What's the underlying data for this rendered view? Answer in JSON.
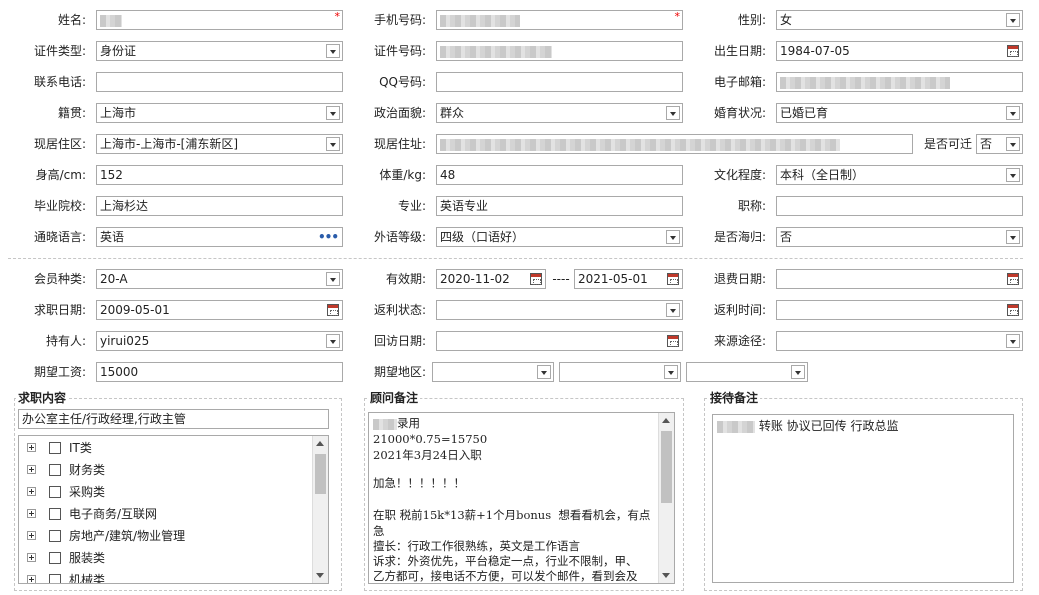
{
  "row1": {
    "name_label": "姓名:",
    "phone_label": "手机号码:",
    "gender_label": "性别:",
    "gender_value": "女"
  },
  "row2": {
    "idtype_label": "证件类型:",
    "idtype_value": "身份证",
    "idnum_label": "证件号码:",
    "birth_label": "出生日期:",
    "birth_value": "1984-07-05"
  },
  "row3": {
    "tel_label": "联系电话:",
    "qq_label": "QQ号码:",
    "email_label": "电子邮箱:"
  },
  "row4": {
    "native_label": "籍贯:",
    "native_value": "上海市",
    "political_label": "政治面貌:",
    "political_value": "群众",
    "marital_label": "婚育状况:",
    "marital_value": "已婚已育"
  },
  "row5": {
    "area_label": "现居住区:",
    "area_value": "上海市-上海市-[浦东新区]",
    "address_label": "现居住址:",
    "relocate_label": "是否可迁",
    "relocate_value": "否"
  },
  "row6": {
    "height_label": "身高/cm:",
    "height_value": "152",
    "weight_label": "体重/kg:",
    "weight_value": "48",
    "education_label": "文化程度:",
    "education_value": "本科（全日制）"
  },
  "row7": {
    "school_label": "毕业院校:",
    "school_value": "上海杉达",
    "major_label": "专业:",
    "major_value": "英语专业",
    "title_label": "职称:"
  },
  "row8": {
    "lang_label": "通晓语言:",
    "lang_value": "英语",
    "lang_more": "•••",
    "level_label": "外语等级:",
    "level_value": "四级（口语好）",
    "overseas_label": "是否海归:",
    "overseas_value": "否"
  },
  "row9": {
    "member_label": "会员种类:",
    "member_value": "20-A",
    "valid_label": "有效期:",
    "valid_from": "2020-11-02",
    "valid_dash": "----",
    "valid_to": "2021-05-01",
    "refund_label": "退费日期:"
  },
  "row10": {
    "jobdate_label": "求职日期:",
    "jobdate_value": "2009-05-01",
    "rebate_status_label": "返利状态:",
    "rebate_time_label": "返利时间:"
  },
  "row11": {
    "holder_label": "持有人:",
    "holder_value": "yirui025",
    "revisit_label": "回访日期:",
    "source_label": "来源途径:"
  },
  "row12": {
    "salary_label": "期望工资:",
    "salary_value": "15000",
    "region_label": "期望地区:"
  },
  "job_panel": {
    "title": "求职内容",
    "selected": "办公室主任/行政经理,行政主管",
    "items": [
      "IT类",
      "财务类",
      "采购类",
      "电子商务/互联网",
      "房地产/建筑/物业管理",
      "服装类",
      "机械类"
    ]
  },
  "consultant_panel": {
    "title": "顾问备注",
    "line1": "录用",
    "line2": "21000*0.75=15750",
    "line3": "2021年3月24日入职",
    "line4": "",
    "line5": "加急！！！！！！",
    "line6": "",
    "line7": "在职 税前15k*13薪+1个月bonus  想看看机会，有点",
    "line8": "急",
    "line9": "擅长：行政工作很熟练，英文是工作语言",
    "line10": "诉求：外资优先，平台稳定一点，行业不限制，甲、",
    "line11": "乙方都可，接电话不方便，可以发个邮件，看到会及"
  },
  "reception_panel": {
    "title": "接待备注",
    "note": "转账 协议已回传 行政总监"
  },
  "colors": {
    "required": "#ee0000",
    "dots": "#2a5caa",
    "border": "#a9a9a9"
  }
}
